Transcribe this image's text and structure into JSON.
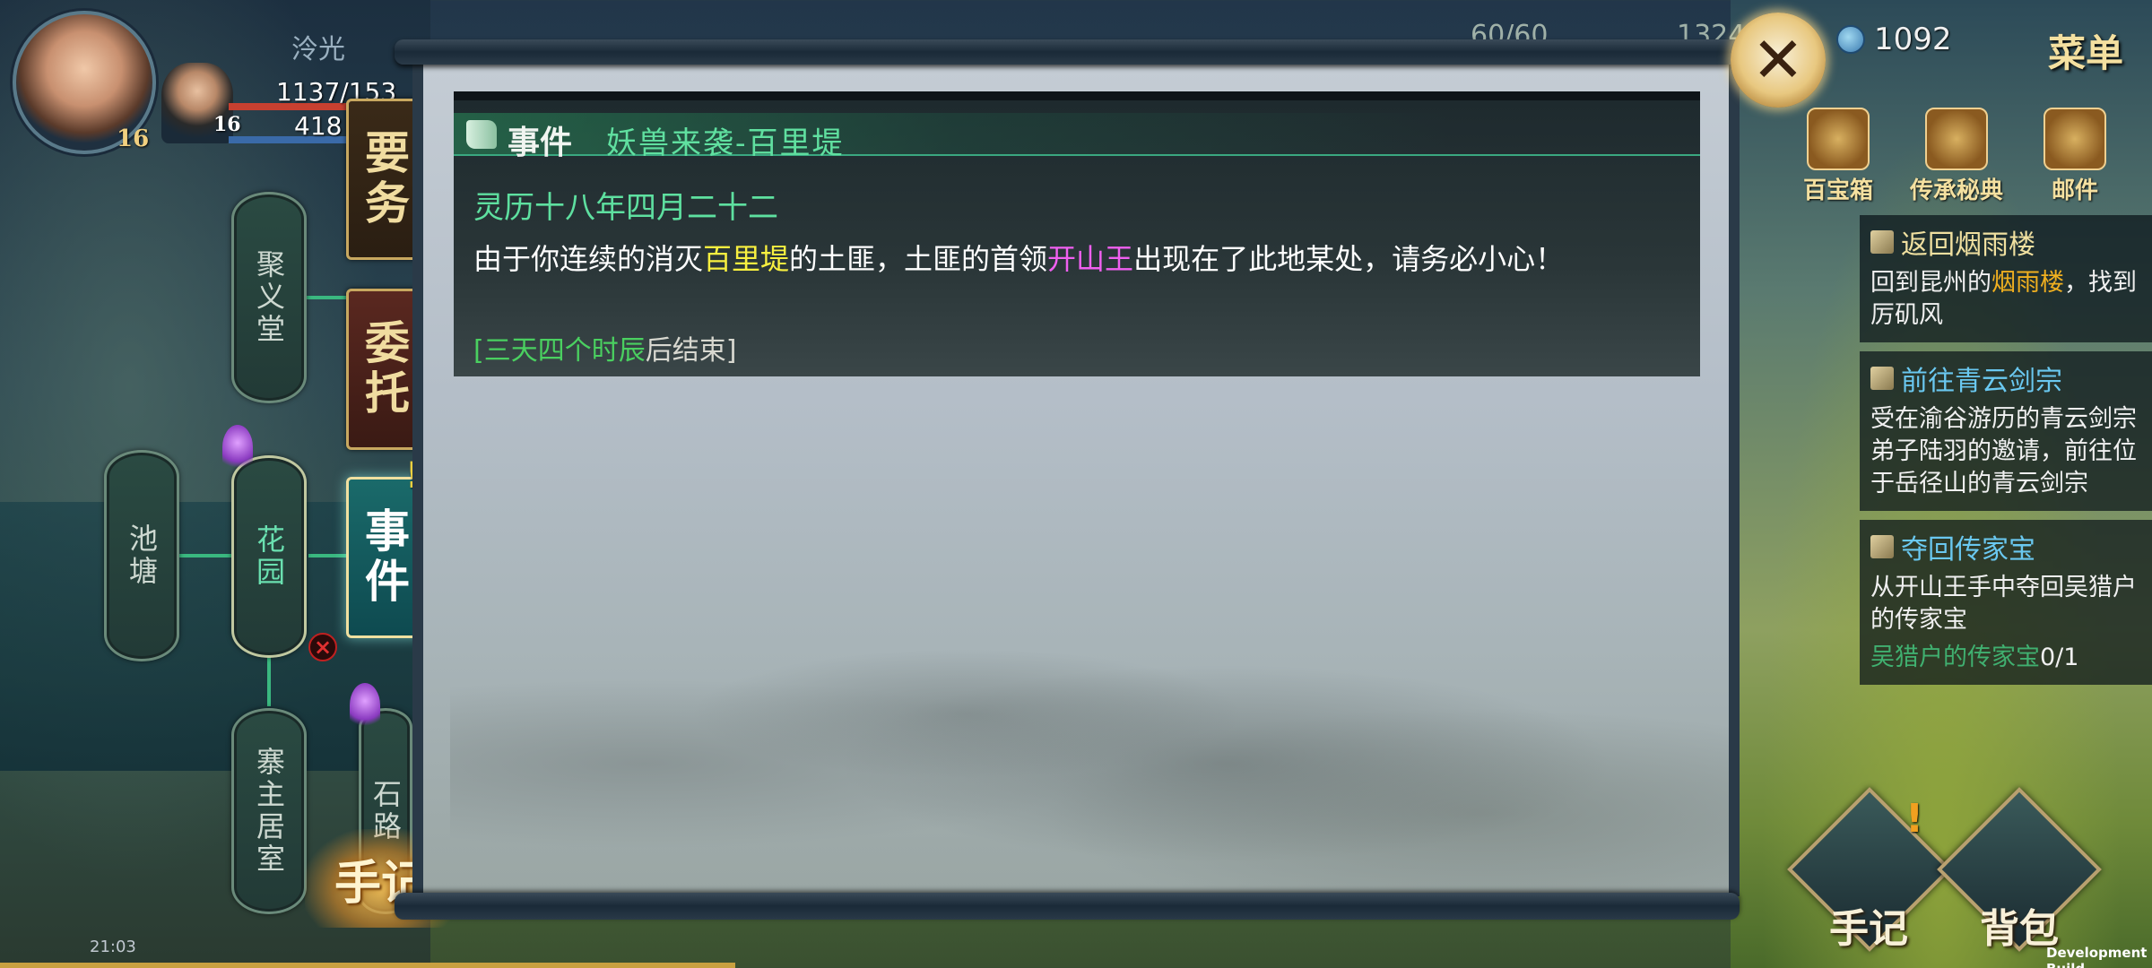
{
  "player": {
    "name": "泠光",
    "hp": "1137/153",
    "mp": "418",
    "level": "16",
    "companion_level": "16"
  },
  "currencies": {
    "stamina": "60/60",
    "silver": "1324",
    "jade": "1092"
  },
  "menu_label": "菜单",
  "close_icon": "✕",
  "top_icons": [
    {
      "label": "百宝箱",
      "icon": "treasure-chest-icon"
    },
    {
      "label": "传承秘典",
      "icon": "book-icon"
    },
    {
      "label": "邮件",
      "icon": "mail-icon"
    }
  ],
  "map_nodes": {
    "juyitang": "聚义堂",
    "huayuan": "花园",
    "chitang": "池塘",
    "zhaizhujushi": "寨主居室",
    "shilu": "石路",
    "partial": "石"
  },
  "tabs": {
    "yaowu": "要务",
    "weituo": "委托",
    "shijian": "事件",
    "alert": "!"
  },
  "journal_left": "手记",
  "status": {
    "time": "21:03"
  },
  "event": {
    "category": "事件",
    "title": "妖兽来袭-百里堤",
    "date": "灵历十八年四月二十二",
    "desc_1": "由于你连续的消灭",
    "desc_place": "百里堤",
    "desc_2": "的土匪，土匪的首领",
    "desc_boss": "开山王",
    "desc_3": "出现在了此地某处，请务必小心！",
    "timer_open": "[",
    "timer_value": "三天四个时辰",
    "timer_close": "后结束]"
  },
  "quests": [
    {
      "title": "返回烟雨楼",
      "body_1": "回到昆州的",
      "body_place": "烟雨楼",
      "body_2": "，找到厉矶风"
    },
    {
      "title": "前往青云剑宗",
      "body": "受在渝谷游历的青云剑宗弟子陆羽的邀请，前往位于岳径山的青云剑宗"
    },
    {
      "title": "夺回传家宝",
      "body": "从开山王手中夺回吴猎户的传家宝",
      "progress_item": "吴猎户的传家宝",
      "progress_count": "0/1"
    }
  ],
  "bottom_buttons": {
    "journal": "手记",
    "bag": "背包",
    "alert": "!"
  },
  "dev_build": "Development Build"
}
